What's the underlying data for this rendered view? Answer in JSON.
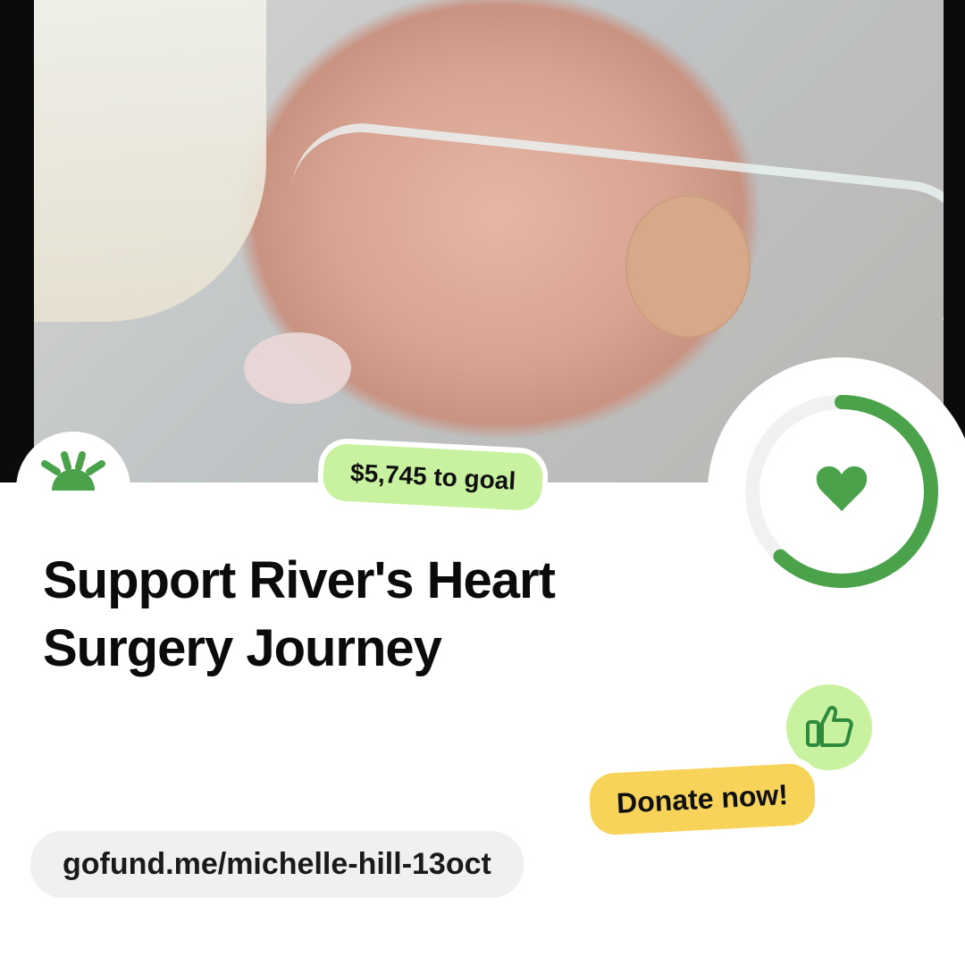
{
  "campaign": {
    "goal_badge": "$5,745 to goal",
    "title": "Support River's Heart Surgery Journey",
    "donate_label": "Donate now!",
    "url": "gofund.me/michelle-hill-13oct",
    "progress_fraction": 0.62
  },
  "colors": {
    "brand_green": "#4aa34a",
    "badge_green": "#c8f2a0",
    "donate_yellow": "#f7d35a",
    "url_pill_gray": "#f0f0f0",
    "ring_track": "#f1f1f1"
  },
  "icons": {
    "logo": "sun-logo-icon",
    "progress_center": "heart-icon",
    "thumbs": "thumbs-up-icon"
  }
}
